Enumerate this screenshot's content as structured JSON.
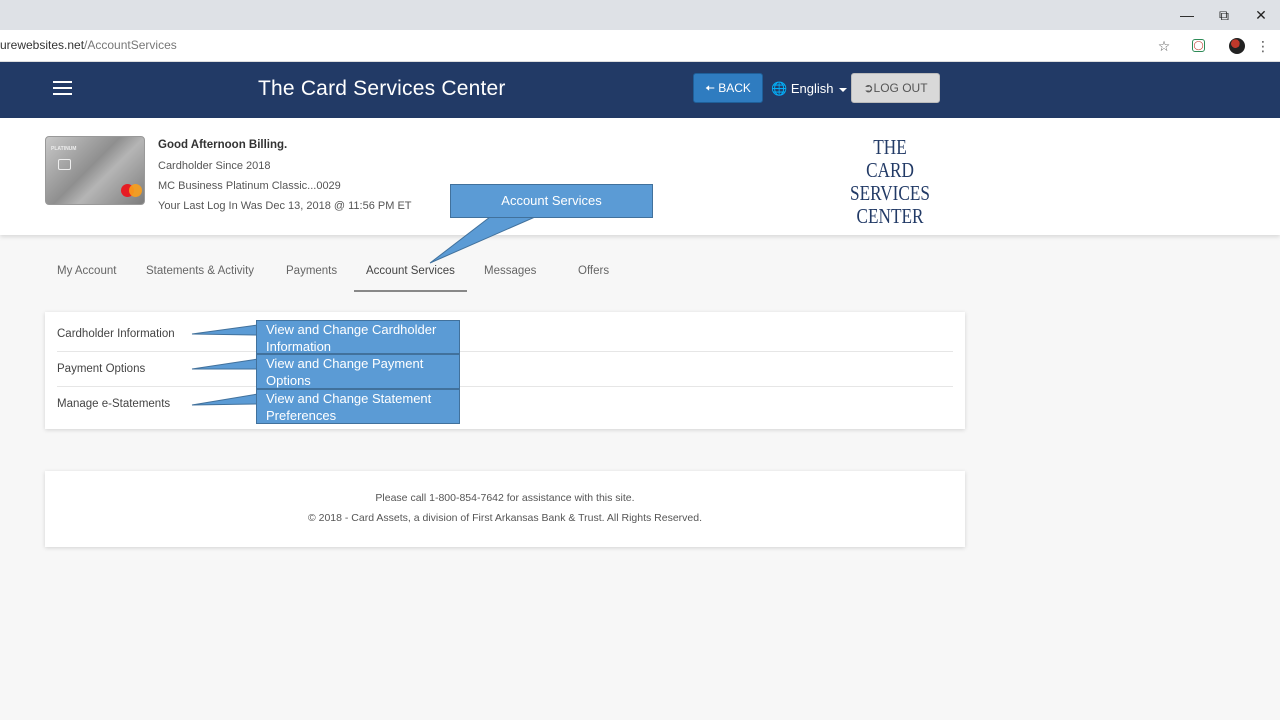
{
  "browser": {
    "url_host": "urewebsites.net",
    "url_path": "/AccountServices",
    "icons": [
      "minimize-icon",
      "restore-icon",
      "close-icon",
      "star-icon",
      "extension-icon",
      "profile-avatar-icon",
      "menu-dots-icon"
    ]
  },
  "header": {
    "title": "The Card Services Center",
    "back_label": "BACK",
    "language": "English",
    "logout_label": "LOG OUT"
  },
  "profile": {
    "greeting": "Good Afternoon Billing.",
    "since": "Cardholder Since 2018",
    "card_name": "MC Business Platinum Classic...0029",
    "last_login": "Your Last Log In Was Dec 13, 2018 @ 11:56 PM ET",
    "card_label": "PLATINUM",
    "logo_lines": [
      "THE",
      "CARD SERVICES",
      "CENTER"
    ]
  },
  "tabs": [
    {
      "label": "My Account"
    },
    {
      "label": "Statements & Activity"
    },
    {
      "label": "Payments"
    },
    {
      "label": "Account Services",
      "active": true
    },
    {
      "label": "Messages"
    },
    {
      "label": "Offers"
    }
  ],
  "services": [
    {
      "label": "Cardholder Information"
    },
    {
      "label": "Payment Options"
    },
    {
      "label": "Manage e-Statements"
    }
  ],
  "callouts": {
    "tab": "Account Services",
    "items": [
      "View and Change Cardholder Information",
      "View and Change Payment Options",
      "View and Change Statement Preferences"
    ]
  },
  "footer": {
    "line1": "Please call 1-800-854-7642 for assistance with this site.",
    "line2": "© 2018 - Card Assets, a division of First Arkansas Bank & Trust. All Rights Reserved."
  },
  "colors": {
    "header_bg": "#223a66",
    "back_button": "#2f7cc0",
    "callout_fill": "#5b9bd5",
    "callout_border": "#41719c"
  }
}
